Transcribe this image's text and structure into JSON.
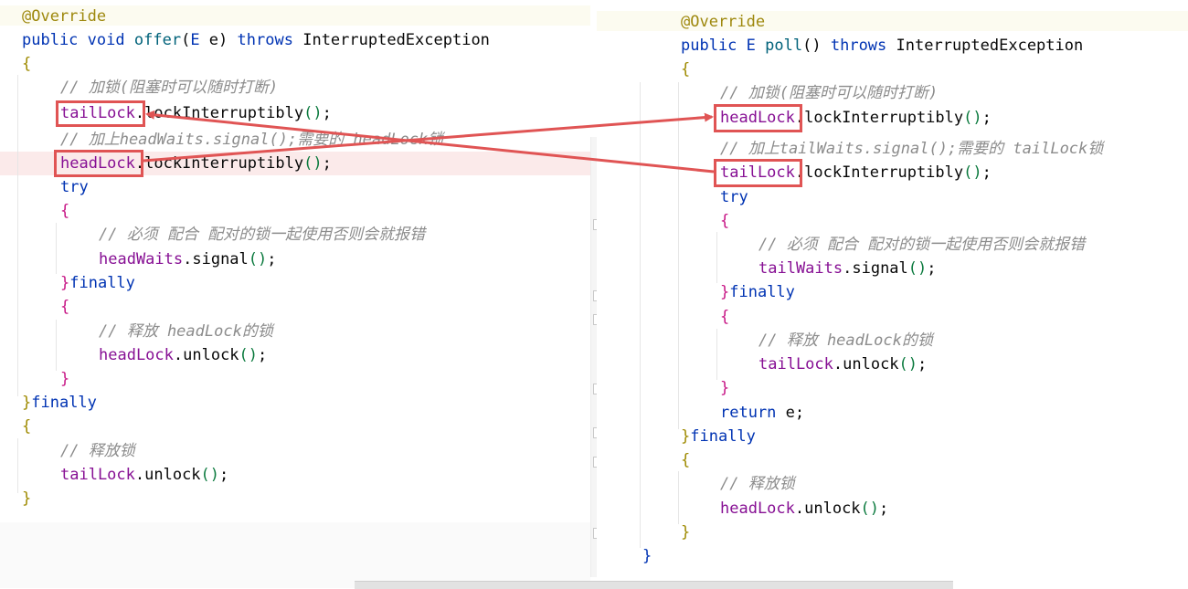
{
  "left": {
    "annotation": "@Override",
    "sig_public": "public",
    "sig_void": "void",
    "sig_name": "offer",
    "sig_params_open": "(",
    "sig_type": "E",
    "sig_param": " e",
    "sig_params_close": ")",
    "sig_throws": "throws",
    "sig_exc": "InterruptedException",
    "open_brace": "{",
    "comment_lock": "// 加锁(阻塞时可以随时打断)",
    "tail_field": "tailLock",
    "tail_call": ".lockInterruptibly",
    "parens": "()",
    "semi": ";",
    "comment_add": "// 加上headWaits.signal();需要的 headLock锁",
    "head_field": "headLock",
    "head_call": ".lockInterruptibly",
    "try_kw": "try",
    "comment_must": "// 必须 配合 配对的锁一起使用否则会就报错",
    "waits_field": "headWaits",
    "waits_call": ".signal",
    "close_brace": "}",
    "finally_kw": "finally",
    "comment_release_head": "// 释放 headLock的锁",
    "unlock_call": ".unlock",
    "comment_release": "// 释放锁"
  },
  "right": {
    "annotation": "@Override",
    "sig_public": "public",
    "sig_type": "E",
    "sig_name": "poll",
    "sig_parens": "()",
    "sig_throws": "throws",
    "sig_exc": "InterruptedException",
    "open_brace": "{",
    "comment_lock": "// 加锁(阻塞时可以随时打断)",
    "head_field": "headLock",
    "lock_call": ".lockInterruptibly",
    "parens": "()",
    "semi": ";",
    "comment_add": "// 加上tailWaits.signal();需要的 tailLock锁",
    "tail_field": "tailLock",
    "try_kw": "try",
    "comment_must": "// 必须 配合 配对的锁一起使用否则会就报错",
    "waits_field": "tailWaits",
    "waits_call": ".signal",
    "close_brace": "}",
    "finally_kw": "finally",
    "comment_release_head": "// 释放 headLock的锁",
    "unlock_call": ".unlock",
    "return_kw": "return",
    "return_val": " e",
    "comment_release": "// 释放锁"
  },
  "colors": {
    "keyword": "#0033b3",
    "field": "#871094",
    "comment": "#8c8c8c",
    "annotation": "#9e880d",
    "highlight_box": "#e05454"
  }
}
